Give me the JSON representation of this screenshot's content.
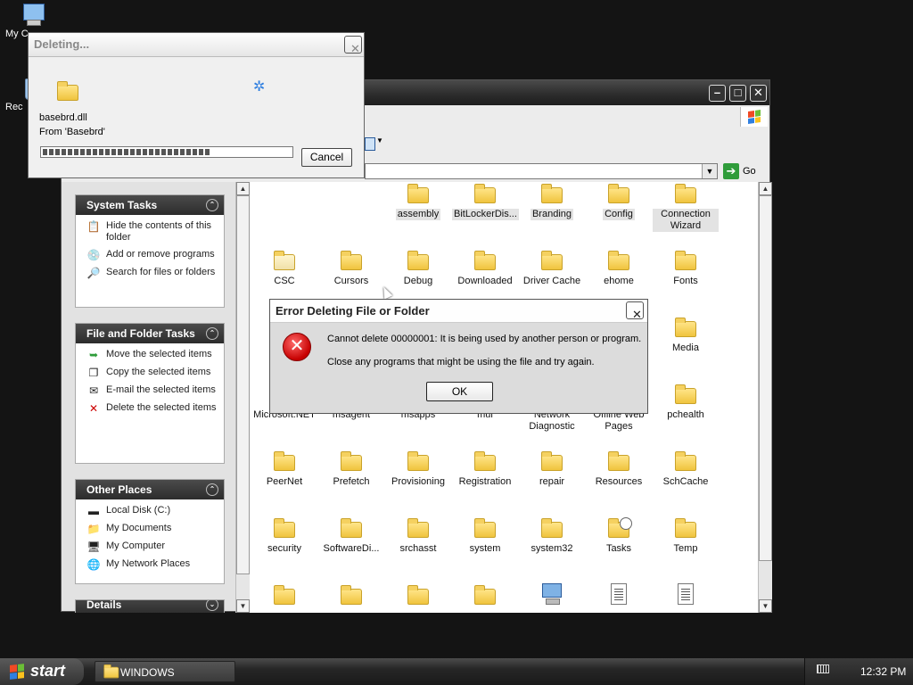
{
  "desktop": {
    "icons": [
      {
        "label": "My C",
        "icon": "my-computer-icon"
      },
      {
        "label": "Rec",
        "icon": "recycle-bin-icon"
      }
    ]
  },
  "explorer": {
    "address": {
      "go_label": "Go"
    },
    "side_panels": {
      "system_tasks": {
        "title": "System Tasks",
        "items": [
          "Hide the contents of this folder",
          "Add or remove programs",
          "Search for files or folders"
        ]
      },
      "file_folder_tasks": {
        "title": "File and Folder Tasks",
        "items": [
          "Move the selected items",
          "Copy the selected items",
          "E-mail the selected items",
          "Delete the selected items"
        ]
      },
      "other_places": {
        "title": "Other Places",
        "items": [
          "Local Disk (C:)",
          "My Documents",
          "My Computer",
          "My Network Places"
        ]
      },
      "details": {
        "title": "Details"
      }
    },
    "folders": [
      {
        "label": "assembly",
        "type": "folder",
        "selected": true
      },
      {
        "label": "BitLockerDis...",
        "type": "folder",
        "selected": true
      },
      {
        "label": "Branding",
        "type": "folder",
        "selected": true
      },
      {
        "label": "Config",
        "type": "folder",
        "selected": true
      },
      {
        "label": "Connection Wizard",
        "type": "folder",
        "selected": true
      },
      {
        "label": "CSC",
        "type": "folder-pale",
        "selected": false
      },
      {
        "label": "Cursors",
        "type": "folder",
        "selected": false
      },
      {
        "label": "Debug",
        "type": "folder",
        "selected": false
      },
      {
        "label": "Downloaded",
        "type": "folder",
        "selected": false
      },
      {
        "label": "Driver Cache",
        "type": "folder",
        "selected": false
      },
      {
        "label": "ehome",
        "type": "folder",
        "selected": false
      },
      {
        "label": "Fonts",
        "type": "folder",
        "selected": false
      },
      {
        "label": "Media",
        "type": "folder",
        "selected": false
      },
      {
        "label": "Microsoft.NET",
        "type": "folder",
        "selected": false
      },
      {
        "label": "msagent",
        "type": "folder",
        "selected": false
      },
      {
        "label": "msapps",
        "type": "folder",
        "selected": false
      },
      {
        "label": "mui",
        "type": "folder",
        "selected": false
      },
      {
        "label": "Network Diagnostic",
        "type": "folder",
        "selected": false
      },
      {
        "label": "Offline Web Pages",
        "type": "folder",
        "selected": false
      },
      {
        "label": "pchealth",
        "type": "folder",
        "selected": false
      },
      {
        "label": "PeerNet",
        "type": "folder",
        "selected": false
      },
      {
        "label": "Prefetch",
        "type": "folder",
        "selected": false
      },
      {
        "label": "Provisioning",
        "type": "folder",
        "selected": false
      },
      {
        "label": "Registration",
        "type": "folder",
        "selected": false
      },
      {
        "label": "repair",
        "type": "folder",
        "selected": false
      },
      {
        "label": "Resources",
        "type": "folder",
        "selected": false
      },
      {
        "label": "SchCache",
        "type": "folder",
        "selected": false
      },
      {
        "label": "security",
        "type": "folder",
        "selected": false
      },
      {
        "label": "SoftwareDi...",
        "type": "folder",
        "selected": false
      },
      {
        "label": "srchasst",
        "type": "folder",
        "selected": false
      },
      {
        "label": "system",
        "type": "folder",
        "selected": false
      },
      {
        "label": "system32",
        "type": "folder",
        "selected": false
      },
      {
        "label": "Tasks",
        "type": "folder",
        "selected": false
      },
      {
        "label": "Temp",
        "type": "folder",
        "selected": false
      }
    ]
  },
  "deleting_dialog": {
    "title": "Deleting...",
    "file_name": "basebrd.dll",
    "from_text": "From 'Basebrd'",
    "progress_percent": 68,
    "cancel_label": "Cancel"
  },
  "error_dialog": {
    "title": "Error Deleting File or Folder",
    "message": "Cannot delete 00000001: It is being used by another person or program.",
    "hint": "Close any programs that might be using the file and try again.",
    "ok_label": "OK"
  },
  "taskbar": {
    "start_label": "start",
    "window_button_label": "WINDOWS",
    "clock": "12:32 PM"
  },
  "colors": {
    "desktop_bg": "#141414",
    "folder_yellow": "#f0c43e",
    "error_red": "#c60000",
    "go_green": "#2f9c3a"
  }
}
